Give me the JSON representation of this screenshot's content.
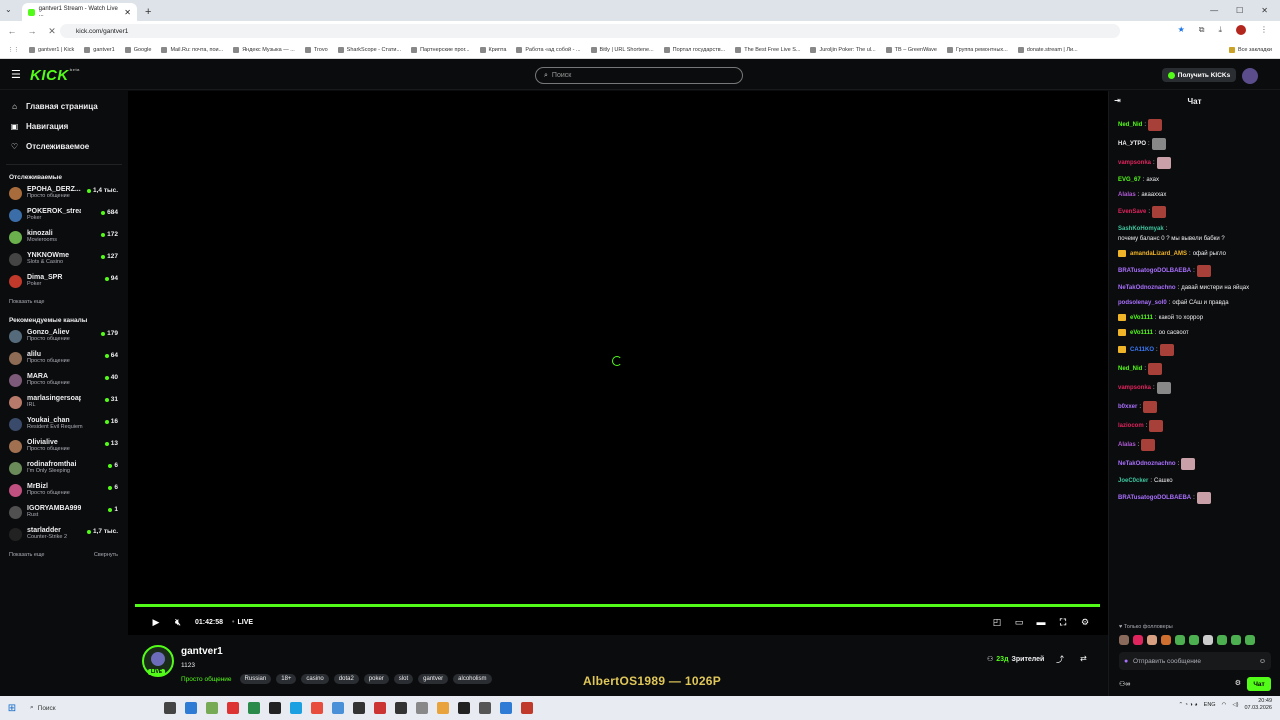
{
  "browser": {
    "tab_title": "gantver1 Stream - Watch Live ...",
    "url": "kick.com/gantver1",
    "bookmarks": [
      "gantver1 | Kick",
      "gantver1",
      "Google",
      "Mail.Ru: почта, пои...",
      "Яндекс Музыка — ...",
      "Trovo",
      "SharkScope - Стати...",
      "Партнерские прог...",
      "Крипта",
      "Работа «ад собой - ...",
      "Bitly | URL Shortene...",
      "Портал государств...",
      "The Best Free Live S...",
      "Juroljin Poker: The ul...",
      "TB – GreenWave",
      "Группа ремонтных...",
      "donate.stream | Ли..."
    ],
    "all_bookmarks": "Все закладки"
  },
  "header": {
    "logo": "KICK",
    "logo_sup": "beta",
    "search_placeholder": "Поиск",
    "kicks_button": "Получить KICKs"
  },
  "sidebar": {
    "menu": [
      {
        "label": "Главная страница",
        "icon": "home-icon"
      },
      {
        "label": "Навигация",
        "icon": "compass-icon"
      },
      {
        "label": "Отслеживаемое",
        "icon": "heart-icon"
      }
    ],
    "following_title": "Отслеживаемые",
    "following": [
      {
        "name": "EPOHA_DERZ...",
        "category": "Просто общение",
        "viewers": "1,4 тыс.",
        "color": "#a86b3c"
      },
      {
        "name": "POKEROK_streams",
        "category": "Poker",
        "viewers": "684",
        "color": "#3b6ea8"
      },
      {
        "name": "kinozali",
        "category": "Movierooms",
        "viewers": "172",
        "color": "#6ab04c"
      },
      {
        "name": "YNKNOWme",
        "category": "Slots & Casino",
        "viewers": "127",
        "color": "#444444"
      },
      {
        "name": "Dima_SPR",
        "category": "Poker",
        "viewers": "94",
        "color": "#c0392b"
      }
    ],
    "show_more": "Показать еще",
    "recommended_title": "Рекомендуемые каналы",
    "recommended": [
      {
        "name": "Gonzo_Aliev",
        "category": "Просто общение",
        "viewers": "179",
        "color": "#556b7c"
      },
      {
        "name": "alilu",
        "category": "Просто общение",
        "viewers": "64",
        "color": "#8e6b55"
      },
      {
        "name": "MARA",
        "category": "Просто общение",
        "viewers": "40",
        "color": "#7d5a7a"
      },
      {
        "name": "marlasingersoap",
        "category": "IRL",
        "viewers": "31",
        "color": "#b87a6a"
      },
      {
        "name": "Youkai_chan",
        "category": "Resident Evil Requiem",
        "viewers": "16",
        "color": "#3a4a6a"
      },
      {
        "name": "Olivialive",
        "category": "Просто общение",
        "viewers": "13",
        "color": "#a07050"
      },
      {
        "name": "rodinafromthai",
        "category": "I'm Only Sleeping",
        "viewers": "6",
        "color": "#6a8a5a"
      },
      {
        "name": "MrBizl",
        "category": "Просто общение",
        "viewers": "6",
        "color": "#c05080"
      },
      {
        "name": "IGORYAMBA999",
        "category": "Rust",
        "viewers": "1",
        "color": "#505050"
      },
      {
        "name": "starladder",
        "category": "Counter-Strike 2",
        "viewers": "1,7 тыс.",
        "color": "#222222"
      }
    ],
    "show_more2": "Показать еще",
    "collapse": "Свернуть"
  },
  "player": {
    "time": "01:42:58",
    "live_label": "LIVE",
    "progress": 1.0
  },
  "stream": {
    "name": "gantver1",
    "title": "1123",
    "live_badge": "LIVE",
    "category": "Просто общение",
    "tags": [
      "Russian",
      "18+",
      "casino",
      "dota2",
      "poker",
      "slot",
      "gantver",
      "alcoholism"
    ],
    "viewers": "23д",
    "viewers_label": "Зрителей",
    "overlay_text": "AlbertOS1989 — 1026P"
  },
  "chat": {
    "title": "Чат",
    "messages": [
      {
        "user": "Ned_Nid",
        "color": "#53fc18",
        "text": "",
        "emote": "r"
      },
      {
        "user": "НА_УТРО",
        "color": "#efeff1",
        "text": "",
        "emote": "g"
      },
      {
        "user": "vampsonka",
        "color": "#e0245e",
        "text": "",
        "emote": "pk"
      },
      {
        "user": "EVG_67",
        "color": "#53fc18",
        "text": "ахах",
        "emote": ""
      },
      {
        "user": "Alalas",
        "color": "#b05bd7",
        "text": "акааххах",
        "emote": ""
      },
      {
        "user": "EvenSave",
        "color": "#e0245e",
        "text": "",
        "emote": "r"
      },
      {
        "user": "SashKoHomyak",
        "color": "#3ec7a0",
        "text": "почему баланс 0 ? мы вывели бабки ?",
        "emote": ""
      },
      {
        "user": "amandaLizard_AMS",
        "color": "#f0b429",
        "text": "офай рыгло",
        "emote": "",
        "crown": true
      },
      {
        "user": "BRATusatogoDOLBAEBA",
        "color": "#a970ff",
        "text": "",
        "emote": "r"
      },
      {
        "user": "NeTakOdnoznachno",
        "color": "#a970ff",
        "text": "давай мистери на яйцах",
        "emote": ""
      },
      {
        "user": "podsolenay_sol0",
        "color": "#a970ff",
        "text": "офай САш и правда",
        "emote": ""
      },
      {
        "user": "eVo1111",
        "color": "#53fc18",
        "text": "какой то хоррор",
        "emote": "",
        "crown": true
      },
      {
        "user": "eVo1111",
        "color": "#53fc18",
        "text": "оо сасвоот",
        "emote": "",
        "crown": true
      },
      {
        "user": "CA11KO",
        "color": "#3a7bff",
        "text": "",
        "emote": "r",
        "crown": true
      },
      {
        "user": "Ned_Nid",
        "color": "#53fc18",
        "text": "",
        "emote": "r"
      },
      {
        "user": "vampsonka",
        "color": "#e0245e",
        "text": "",
        "emote": "g"
      },
      {
        "user": "b0xxer",
        "color": "#a970ff",
        "text": "",
        "emote": "r"
      },
      {
        "user": "laziocom",
        "color": "#e0245e",
        "text": "",
        "emote": "r"
      },
      {
        "user": "Alalas",
        "color": "#b05bd7",
        "text": "",
        "emote": "r"
      },
      {
        "user": "NeTakOdnoznachno",
        "color": "#a970ff",
        "text": "",
        "emote": "pk"
      },
      {
        "user": "JoeC0cker",
        "color": "#3ec7a0",
        "text": "Сашко",
        "emote": ""
      },
      {
        "user": "BRATusatogoDOLBAEBA",
        "color": "#a970ff",
        "text": "",
        "emote": "pk"
      }
    ],
    "followers_only": "Только фолловеры",
    "input_placeholder": "Отправить сообщение",
    "send_label": "Чат"
  },
  "taskbar": {
    "search": "Поиск",
    "lang": "ENG",
    "time": "20:49",
    "date": "07.03.2026"
  }
}
